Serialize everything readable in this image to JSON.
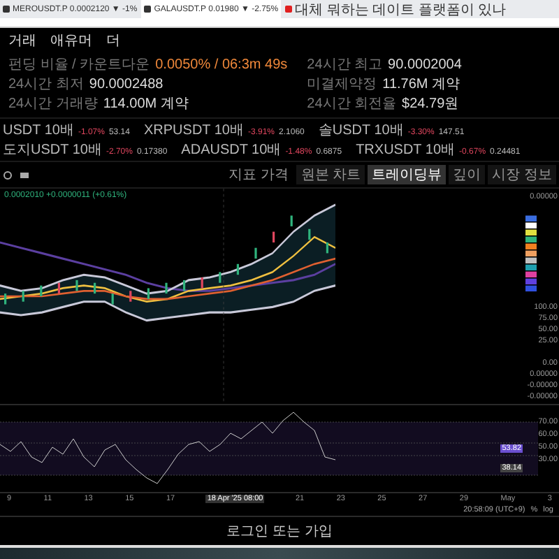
{
  "browser_tabs": [
    {
      "title": "MEROUSDT.P 0.0002120 ▼ -1%",
      "selected": false
    },
    {
      "title": "GALAUSDT.P 0.01980 ▼ -2.75%",
      "selected": true
    },
    {
      "title": "대체 뭐하는 데이트 플랫폼이 있나",
      "selected": false,
      "kind": "video"
    }
  ],
  "nav": [
    "거래",
    "애유머",
    "더"
  ],
  "stats": [
    {
      "label": "펀딩 비율 / 카운트다운",
      "value": "0.0050% / 06:3m 49s",
      "kind": "alert"
    },
    {
      "label": "24시간 최고",
      "value": "90.0002004",
      "kind": "plain"
    },
    {
      "label": "24시간 최저",
      "value": "90.0002488",
      "kind": "plain"
    },
    {
      "label": "미결제약정",
      "value": "11.76M 계약",
      "kind": "plain"
    },
    {
      "label": "24시간 거래량",
      "value": "114.00M 계약",
      "kind": "plain"
    },
    {
      "label": "24시간 회전율",
      "value": "$24.79원",
      "kind": "plain"
    }
  ],
  "tickers": [
    {
      "pair": "USDT 10배",
      "change": "-1.07%",
      "price": "53.14"
    },
    {
      "pair": "XRPUSDT 10배",
      "change": "-3.91%",
      "price": "2.1060"
    },
    {
      "pair": "솔USDT 10배",
      "change": "-3.30%",
      "price": "147.51"
    },
    {
      "pair": "도지USDT 10배",
      "change": "-2.70%",
      "price": "0.17380"
    },
    {
      "pair": "ADAUSDT 10배",
      "change": "-1.48%",
      "price": "0.6875"
    },
    {
      "pair": "TRXUSDT 10배",
      "change": "-0.67%",
      "price": "0.24481"
    }
  ],
  "view_tabs": [
    {
      "label": "원본 차트",
      "selected": false
    },
    {
      "label": "트레이딩뷰",
      "selected": true
    },
    {
      "label": "깊이",
      "selected": false
    },
    {
      "label": "시장 정보",
      "selected": false
    }
  ],
  "price_select": "지표 가격",
  "legend": "0.0002010 +0.0000011 (+0.61%)",
  "main_axis": [
    "0.00000",
    "100.00",
    "75.00",
    "50.00",
    "25.00"
  ],
  "mid_axis": [
    "0.00",
    "0.00000",
    "-0.00000",
    "-0.00000"
  ],
  "rsi_axis": [
    "70.00",
    "60.00",
    "50.00",
    "30.00"
  ],
  "rsi_value": "53.82",
  "rsi_value2": "38.14",
  "x_axis": [
    "9",
    "11",
    "13",
    "15",
    "17",
    "18 Apr '25  08:00",
    "21",
    "23",
    "25",
    "27",
    "29",
    "May",
    "3"
  ],
  "time": "20:58:09 (UTC+9)",
  "scale_buttons": [
    "%",
    "log"
  ],
  "footer": "로그인 또는 가입"
}
